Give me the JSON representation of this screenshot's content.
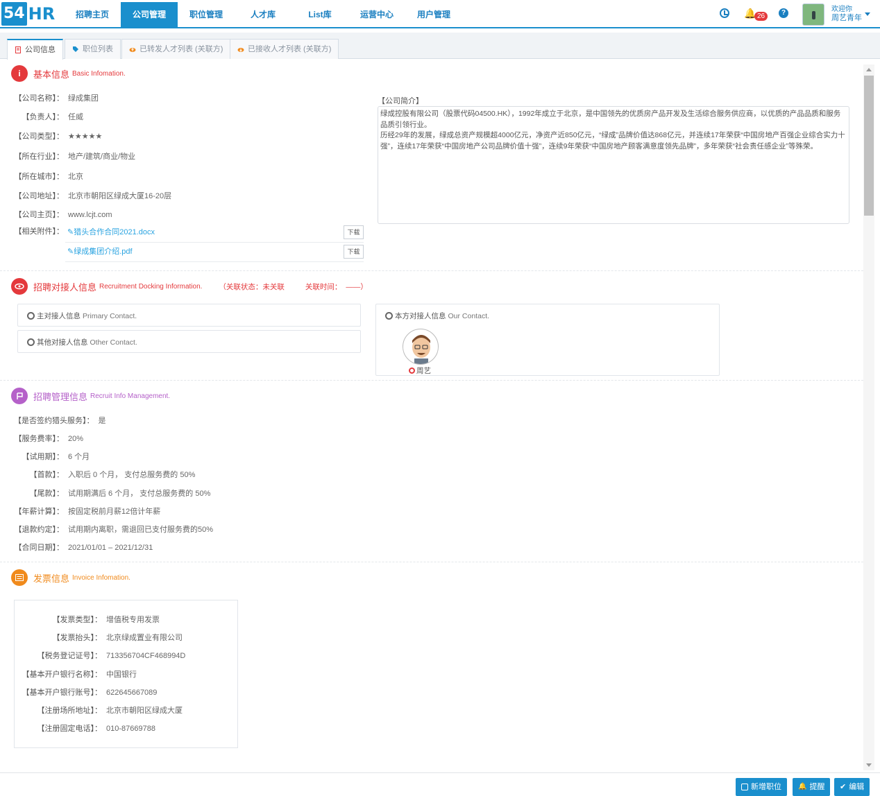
{
  "app": {
    "logo_num": "54",
    "logo_text": "HR",
    "nav": [
      "招聘主页",
      "公司管理",
      "职位管理",
      "人才库",
      "List库",
      "运营中心",
      "用户管理"
    ],
    "active_nav": 1,
    "notifications_count": "26",
    "welcome": "欢迎你",
    "username": "周艺青年"
  },
  "tabs": [
    {
      "label": "公司信息",
      "active": true,
      "icon": "document-icon"
    },
    {
      "label": "职位列表",
      "active": false,
      "icon": "tag-icon"
    },
    {
      "label": "已转发人才列表 (关联方)",
      "active": false,
      "icon": "cloud-upload-icon"
    },
    {
      "label": "已接收人才列表 (关联方)",
      "active": false,
      "icon": "cloud-download-icon"
    }
  ],
  "basic": {
    "title_cn": "基本信息",
    "title_en": "Basic Infomation.",
    "fields": [
      {
        "label": "【公司名称】：",
        "value": "绿成集团"
      },
      {
        "label": "【负责人】：",
        "value": "任威"
      },
      {
        "label": "【公司类型】：",
        "value": "★★★★★"
      },
      {
        "label": "【所在行业】：",
        "value": "地产/建筑/商业/物业"
      },
      {
        "label": "【所在城市】：",
        "value": "北京"
      },
      {
        "label": "【公司地址】：",
        "value": "北京市朝阳区绿成大厦16-20层"
      },
      {
        "label": "【公司主页】：",
        "value": "www.lcjt.com"
      }
    ],
    "attach_label": "【相关附件】：",
    "attachments": [
      "猎头合作合同2021.docx",
      "绿成集团介绍.pdf"
    ],
    "download_label": "下载",
    "intro_label": "【公司简介】",
    "intro_p1": "绿成控股有限公司（股票代码04500.HK），1992年成立于北京，是中国领先的优质房产品开发及生活综合服务供应商，以优质的产品品质和服务品质引领行业。",
    "intro_p2": "历经29年的发展，绿成总资产规模超4000亿元，净资产近850亿元，“绿成”品牌价值达868亿元，并连续17年荣获“中国房地产百强企业综合实力十强”，连续17年荣获“中国房地产公司品牌价值十强”，连续9年荣获“中国房地产顾客满意度领先品牌”，多年荣获“社会责任感企业”等殊荣。"
  },
  "docking": {
    "title_cn": "招聘对接人信息",
    "title_en": "Recruitment Docking Information.",
    "status_open": "（关联状态：",
    "status_value": "未关联",
    "time_label": "关联时间：",
    "time_value": "——",
    "time_close": "）",
    "primary_cn": "主对接人信息",
    "primary_en": "Primary Contact.",
    "other_cn": "其他对接人信息",
    "other_en": "Other Contact.",
    "our_cn": "本方对接人信息",
    "our_en": "Our Contact.",
    "our_person": "周艺"
  },
  "recruit": {
    "title_cn": "招聘管理信息",
    "title_en": "Recruit Info Management.",
    "fields": [
      {
        "label": "【是否签约猎头服务】：",
        "value": "是"
      },
      {
        "label": "【服务费率】：",
        "value": "20%"
      },
      {
        "label": "【试用期】：",
        "value": "6 个月"
      },
      {
        "label": "【首款】：",
        "value": "入职后 0 个月，  支付总服务费的 50%"
      },
      {
        "label": "【尾款】：",
        "value": "试用期满后 6 个月，  支付总服务费的 50%"
      },
      {
        "label": "【年薪计算】：",
        "value": "按固定税前月薪12倍计年薪"
      },
      {
        "label": "【退款约定】：",
        "value": "试用期内离职，需退回已支付服务费的50%"
      },
      {
        "label": "【合同日期】：",
        "value": "2021/01/01 – 2021/12/31"
      }
    ]
  },
  "invoice": {
    "title_cn": "发票信息",
    "title_en": "Invoice Infomation.",
    "fields": [
      {
        "label": "【发票类型】：",
        "value": "增值税专用发票"
      },
      {
        "label": "【发票抬头】：",
        "value": "北京绿成置业有限公司"
      },
      {
        "label": "【税务登记证号】：",
        "value": "713356704CF468994D"
      },
      {
        "label": "【基本开户银行名称】：",
        "value": "中国银行"
      },
      {
        "label": "【基本开户银行账号】：",
        "value": "622645667089"
      },
      {
        "label": "【注册场所地址】：",
        "value": "北京市朝阳区绿成大厦"
      },
      {
        "label": "【注册固定电话】：",
        "value": "010-87669788"
      }
    ]
  },
  "actions": {
    "new_job": "新增职位",
    "remind": "提醒",
    "edit": "编辑"
  },
  "colors": {
    "primary": "#1a8fcd",
    "basic": "#e4393c",
    "docking": "#e4393c",
    "recruit": "#b561c9",
    "invoice": "#f08a1c"
  }
}
